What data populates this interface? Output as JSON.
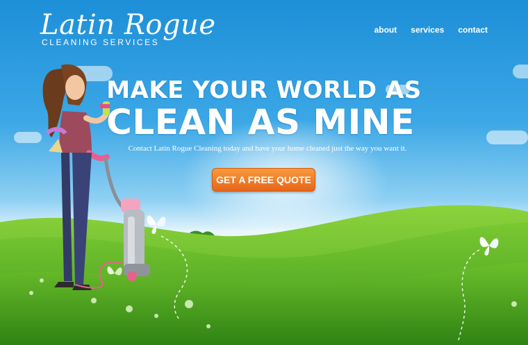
{
  "brand": {
    "name": "Latin Rogue",
    "subtitle": "CLEANING SERVICES"
  },
  "nav": {
    "items": [
      "about",
      "services",
      "contact"
    ]
  },
  "hero": {
    "headline_line1": "MAKE YOUR WORLD AS",
    "headline_line2": "CLEAN AS MINE",
    "tagline": "Contact Latin Rogue Cleaning today and have your home cleaned just the way you want it.",
    "cta_label": "GET A FREE QUOTE"
  },
  "colors": {
    "sky_top": "#1d8fd8",
    "sky_light": "#8fd0f3",
    "grass": "#6dbb2a",
    "grass_dark": "#3f9a1c",
    "cta": "#ef7b22",
    "text": "#ffffff"
  },
  "icons": [
    "butterfly-icon",
    "flower-icon"
  ]
}
